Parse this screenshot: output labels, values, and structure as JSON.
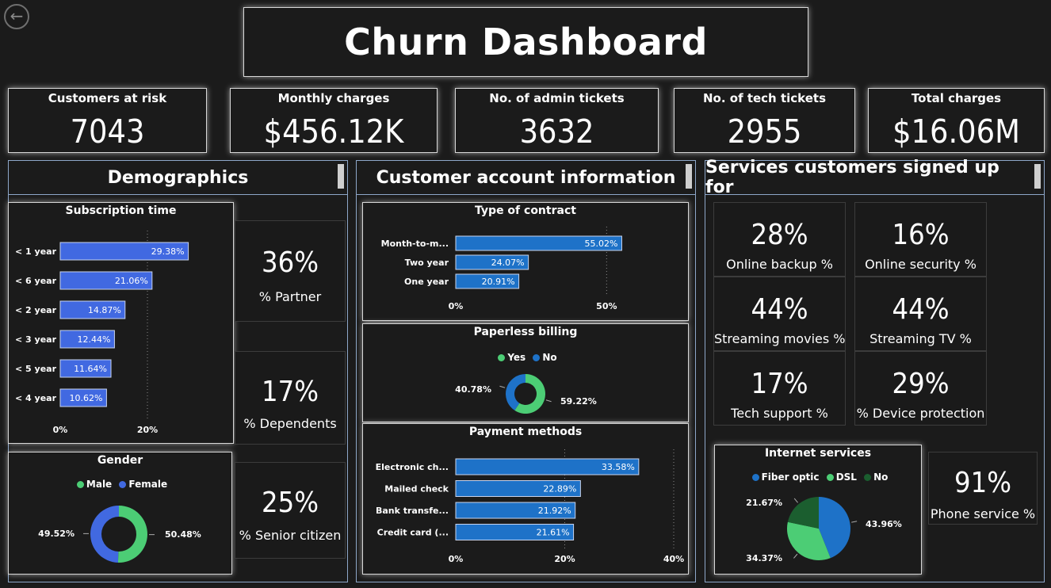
{
  "header": {
    "title": "Churn Dashboard",
    "back_icon": "back-arrow-icon"
  },
  "kpis": [
    {
      "label": "Customers at risk",
      "value": "7043"
    },
    {
      "label": "Monthly charges",
      "value": "$456.12K"
    },
    {
      "label": "No. of admin tickets",
      "value": "3632"
    },
    {
      "label": "No. of tech tickets",
      "value": "2955"
    },
    {
      "label": "Total charges",
      "value": "$16.06M"
    }
  ],
  "sections": {
    "demographics": "Demographics",
    "account": "Customer account information",
    "services": "Services customers signed up for"
  },
  "demographics": {
    "partner": {
      "value": "36%",
      "label": "% Partner"
    },
    "dependents": {
      "value": "17%",
      "label": "% Dependents"
    },
    "senior": {
      "value": "25%",
      "label": "% Senior citizen"
    }
  },
  "services": {
    "tiles": [
      {
        "value": "28%",
        "label": "Online backup %"
      },
      {
        "value": "16%",
        "label": "Online security %"
      },
      {
        "value": "44%",
        "label": "Streaming movies %"
      },
      {
        "value": "44%",
        "label": "Streaming TV %"
      },
      {
        "value": "17%",
        "label": "Tech support %"
      },
      {
        "value": "29%",
        "label": "% Device protection"
      }
    ],
    "phone": {
      "value": "91%",
      "label": "Phone service %"
    }
  },
  "colors": {
    "bar_subscription": "#4169e1",
    "bar_account": "#1e72c8",
    "green": "#4ccd75",
    "blue": "#1e72c8",
    "dark_green": "#1b5e2f"
  },
  "chart_data": [
    {
      "id": "subscription",
      "type": "bar",
      "orientation": "horizontal",
      "title": "Subscription time",
      "categories": [
        "< 1 year",
        "< 6 year",
        "< 2 year",
        "< 3 year",
        "< 5 year",
        "< 4 year"
      ],
      "values": [
        29.38,
        21.06,
        14.87,
        12.44,
        11.64,
        10.62
      ],
      "labels": [
        "29.38%",
        "21.06%",
        "14.87%",
        "12.44%",
        "11.64%",
        "10.62%"
      ],
      "ticks": [
        "0%",
        "20%"
      ],
      "xlim": [
        0,
        30
      ]
    },
    {
      "id": "contract",
      "type": "bar",
      "orientation": "horizontal",
      "title": "Type of contract",
      "categories": [
        "Month-to-m...",
        "Two year",
        "One year"
      ],
      "values": [
        55.02,
        24.07,
        20.91
      ],
      "labels": [
        "55.02%",
        "24.07%",
        "20.91%"
      ],
      "ticks": [
        "0%",
        "50%"
      ],
      "xlim": [
        0,
        57
      ]
    },
    {
      "id": "payment",
      "type": "bar",
      "orientation": "horizontal",
      "title": "Payment methods",
      "categories": [
        "Electronic ch...",
        "Mailed check",
        "Bank transfe...",
        "Credit card (..."
      ],
      "values": [
        33.58,
        22.89,
        21.92,
        21.61
      ],
      "labels": [
        "33.58%",
        "22.89%",
        "21.92%",
        "21.61%"
      ],
      "ticks": [
        "0%",
        "20%",
        "40%"
      ],
      "xlim": [
        0,
        40
      ]
    },
    {
      "id": "paperless",
      "type": "pie",
      "donut": true,
      "title": "Paperless billing",
      "legend": [
        "Yes",
        "No"
      ],
      "values": [
        59.22,
        40.78
      ],
      "labels": [
        "59.22%",
        "40.78%"
      ],
      "colors": [
        "#4ccd75",
        "#1e72c8"
      ]
    },
    {
      "id": "gender",
      "type": "pie",
      "donut": true,
      "title": "Gender",
      "legend": [
        "Male",
        "Female"
      ],
      "values": [
        50.48,
        49.52
      ],
      "labels": [
        "50.48%",
        "49.52%"
      ],
      "colors": [
        "#4ccd75",
        "#4169e1"
      ]
    },
    {
      "id": "internet",
      "type": "pie",
      "donut": false,
      "title": "Internet services",
      "legend": [
        "Fiber optic",
        "DSL",
        "No"
      ],
      "values": [
        43.96,
        34.37,
        21.67
      ],
      "labels": [
        "43.96%",
        "34.37%",
        "21.67%"
      ],
      "colors": [
        "#1e72c8",
        "#4ccd75",
        "#1b5e2f"
      ]
    }
  ]
}
